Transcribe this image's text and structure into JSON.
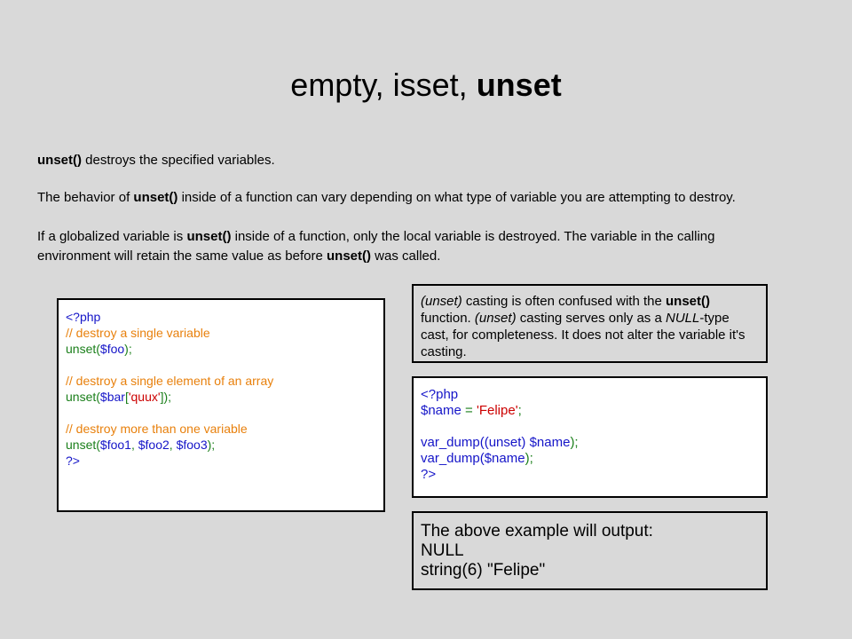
{
  "slide": {
    "title_plain": "empty, isset, ",
    "title_bold": "unset"
  },
  "paragraphs": {
    "p1": {
      "b1": "unset()",
      "t1": " destroys the specified variables."
    },
    "p2": {
      "t0": "The behavior of ",
      "b1": "unset()",
      "t1": " inside of a function can vary depending on what type of variable you are attempting to destroy."
    },
    "p3": {
      "t0": "If a globalized variable is ",
      "b1": "unset()",
      "t1": " inside of a function, only the local variable is destroyed. The variable in the calling environment will retain the same value as before ",
      "b2": "unset()",
      "t2": " was called."
    }
  },
  "code_left": {
    "l1": "<?php",
    "l2": "// destroy a single variable",
    "l3a": "unset(",
    "l3b": "$foo",
    "l3c": ");",
    "l5": "// destroy a single element of an array",
    "l6a": "unset(",
    "l6b": "$bar",
    "l6c": "[",
    "l6d": "'quux'",
    "l6e": "]);",
    "l8": "// destroy more than one variable",
    "l9a": "unset(",
    "l9b": "$foo1",
    "l9c": ", ",
    "l9d": "$foo2",
    "l9e": ", ",
    "l9f": "$foo3",
    "l9g": ");",
    "l10": "?>"
  },
  "note": {
    "i1": "(unset)",
    "t1": " casting is often confused with the ",
    "b1": "unset()",
    "t2": " function. ",
    "i2": "(unset)",
    "t3": " casting serves only as a ",
    "i3": "NULL",
    "t4": "-type cast, for completeness. It does not alter the variable it's casting."
  },
  "code_right": {
    "l1": "<?php",
    "l2a": "$name",
    "l2b": " = ",
    "l2c": "'Felipe'",
    "l2d": ";",
    "l4a": "var_dump((unset) ",
    "l4b": "$name",
    "l4c": ");",
    "l5a": "var_dump(",
    "l5b": "$name",
    "l5c": ");",
    "l6": "?>"
  },
  "output": {
    "l1": "The above example will output:",
    "l2": "NULL",
    "l3": "string(6) \"Felipe\""
  }
}
